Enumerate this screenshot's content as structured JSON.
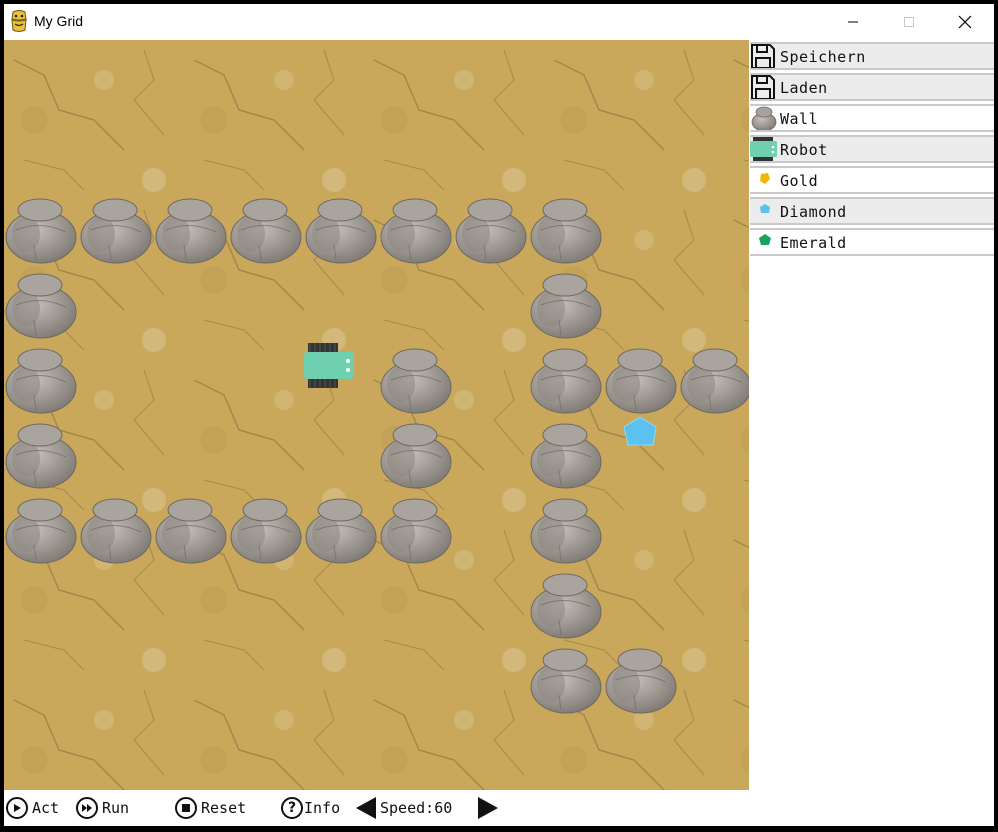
{
  "window": {
    "title": "My Grid",
    "icon": "python-icon",
    "controls": [
      "minimize-icon",
      "maximize-icon",
      "close-icon"
    ]
  },
  "sidebar": {
    "items": [
      {
        "label": "Speichern",
        "icon": "save-icon"
      },
      {
        "label": "Laden",
        "icon": "load-icon"
      },
      {
        "label": "Wall",
        "icon": "rock-icon"
      },
      {
        "label": "Robot",
        "icon": "robot-icon"
      },
      {
        "label": "Gold",
        "icon": "gold-icon"
      },
      {
        "label": "Diamond",
        "icon": "diamond-icon"
      },
      {
        "label": "Emerald",
        "icon": "emerald-icon"
      }
    ]
  },
  "toolbar": {
    "act": "Act",
    "run": "Run",
    "reset": "Reset",
    "info": "Info",
    "speed_label": "Speed:",
    "speed_value": "60"
  },
  "grid": {
    "columns": 10,
    "rows": 10,
    "walls": [
      [
        0,
        2
      ],
      [
        1,
        2
      ],
      [
        2,
        2
      ],
      [
        3,
        2
      ],
      [
        4,
        2
      ],
      [
        5,
        2
      ],
      [
        6,
        2
      ],
      [
        7,
        2
      ],
      [
        0,
        3
      ],
      [
        7,
        3
      ],
      [
        0,
        4
      ],
      [
        5,
        4
      ],
      [
        7,
        4
      ],
      [
        8,
        4
      ],
      [
        9,
        4
      ],
      [
        0,
        5
      ],
      [
        5,
        5
      ],
      [
        7,
        5
      ],
      [
        0,
        6
      ],
      [
        1,
        6
      ],
      [
        2,
        6
      ],
      [
        3,
        6
      ],
      [
        4,
        6
      ],
      [
        5,
        6
      ],
      [
        7,
        6
      ],
      [
        7,
        7
      ],
      [
        7,
        8
      ],
      [
        8,
        8
      ]
    ],
    "robot": [
      4,
      4
    ],
    "diamonds": [
      [
        8,
        5
      ]
    ],
    "colors": {
      "ground": "#c9a85c",
      "rock": "#9a948f",
      "robot": "#6fd0b0",
      "diamond": "#5bc2f0",
      "gold": "#f2b705",
      "emerald": "#1aa35a"
    }
  }
}
